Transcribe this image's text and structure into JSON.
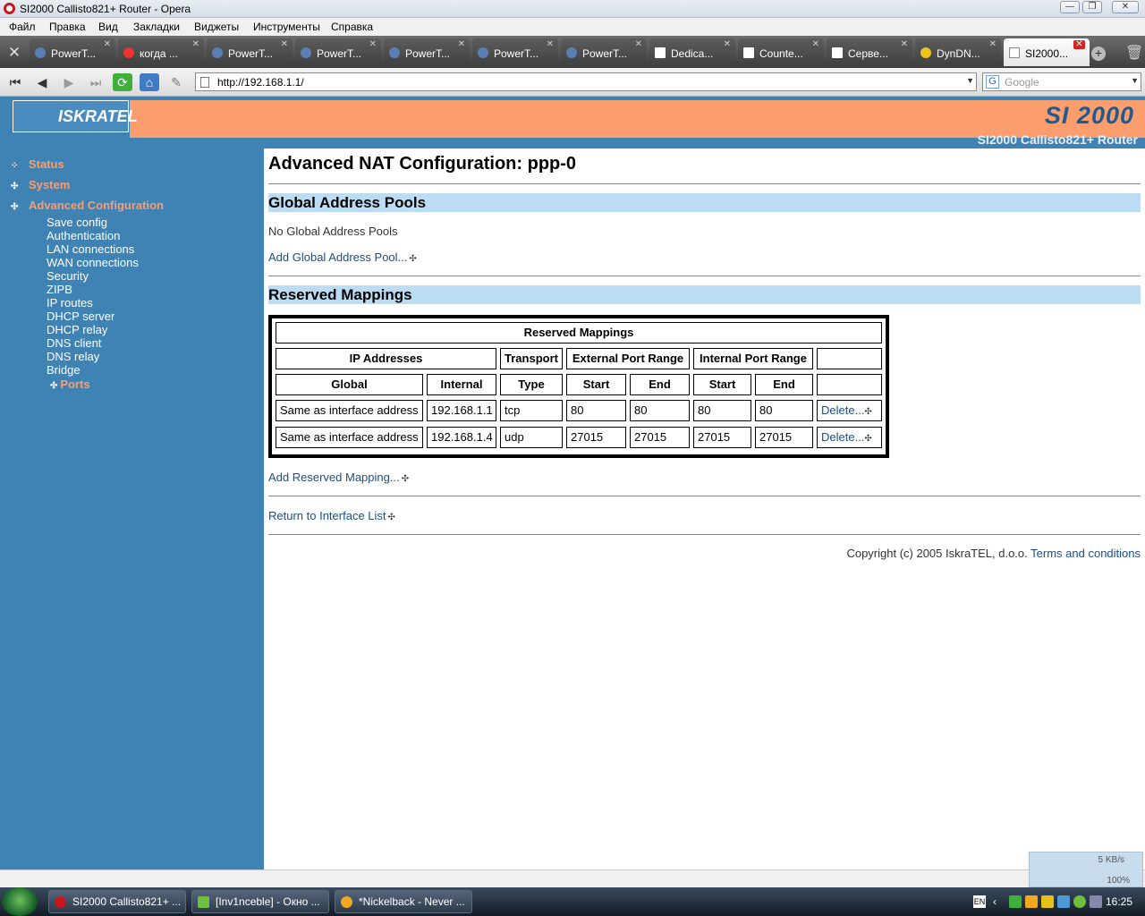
{
  "window": {
    "title": "SI2000 Callisto821+ Router - Opera"
  },
  "menu": [
    "Файл",
    "Правка",
    "Вид",
    "Закладки",
    "Виджеты",
    "Инструменты",
    "Справка"
  ],
  "tabs": [
    {
      "label": "PowerT...",
      "icon": "globe-icon"
    },
    {
      "label": "когда ...",
      "icon": "google-icon"
    },
    {
      "label": "PowerT...",
      "icon": "globe-icon"
    },
    {
      "label": "PowerT...",
      "icon": "globe-icon"
    },
    {
      "label": "PowerT...",
      "icon": "globe-icon"
    },
    {
      "label": "PowerT...",
      "icon": "globe-icon"
    },
    {
      "label": "PowerT...",
      "icon": "globe-icon"
    },
    {
      "label": "Dedica...",
      "icon": "lambda-icon"
    },
    {
      "label": "Counte...",
      "icon": "lambda-icon"
    },
    {
      "label": "Серве...",
      "icon": "lambda-icon"
    },
    {
      "label": "DynDN...",
      "icon": "moon-icon"
    },
    {
      "label": "SI2000...",
      "icon": "page-icon",
      "active": true
    }
  ],
  "address": {
    "url": "http://192.168.1.1/",
    "search_placeholder": "Google"
  },
  "header": {
    "brand": "SI 2000",
    "logo": "ISKRATEL",
    "subtitle": "SI2000 Callisto821+ Router"
  },
  "sidebar": {
    "top": [
      {
        "label": "Status"
      },
      {
        "label": "System"
      },
      {
        "label": "Advanced Configuration"
      }
    ],
    "sub": [
      "Save config",
      "Authentication",
      "LAN connections",
      "WAN connections",
      "Security",
      "ZIPB",
      "IP routes",
      "DHCP server",
      "DHCP relay",
      "DNS client",
      "DNS relay",
      "Bridge"
    ],
    "selected": "Ports"
  },
  "main": {
    "title": "Advanced NAT Configuration: ppp-0",
    "pools_heading": "Global Address Pools",
    "pools_empty": "No Global Address Pools",
    "add_pool": "Add Global Address Pool...",
    "mappings_heading": "Reserved Mappings",
    "table": {
      "caption": "Reserved Mappings",
      "group_headers": [
        "IP Addresses",
        "Transport",
        "External Port Range",
        "Internal Port Range"
      ],
      "col_headers": [
        "Global",
        "Internal",
        "Type",
        "Start",
        "End",
        "Start",
        "End"
      ],
      "rows": [
        {
          "global": "Same as interface address",
          "internal": "192.168.1.1",
          "type": "tcp",
          "ext_start": "80",
          "ext_end": "80",
          "int_start": "80",
          "int_end": "80",
          "action": "Delete..."
        },
        {
          "global": "Same as interface address",
          "internal": "192.168.1.4",
          "type": "udp",
          "ext_start": "27015",
          "ext_end": "27015",
          "int_start": "27015",
          "int_end": "27015",
          "action": "Delete..."
        }
      ]
    },
    "add_mapping": "Add Reserved Mapping...",
    "return_link": "Return to Interface List",
    "copyright": "Copyright (c) 2005 IskraTEL, d.o.o.",
    "terms": "Terms and conditions"
  },
  "status": {
    "speed": "5 KB/s",
    "zoom": "100%"
  },
  "taskbar": {
    "buttons": [
      "SI2000 Callisto821+ ...",
      "[Inv1nceble] - Окно ...",
      "*Nickelback - Never ..."
    ],
    "lang": "EN",
    "clock": "16:25"
  }
}
